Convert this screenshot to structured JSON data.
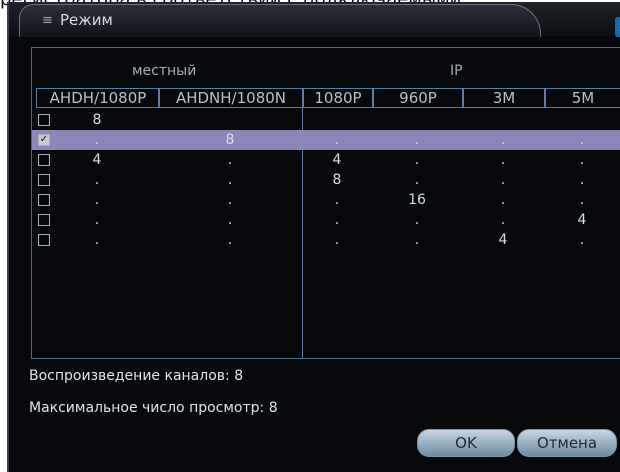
{
  "top_caption": "регистратора в соответствии с подключаемыми",
  "window": {
    "title": "Режим"
  },
  "groups": {
    "local": "местный",
    "ip": "IP"
  },
  "columns": [
    "AHDH/1080P",
    "AHDNH/1080N",
    "1080P",
    "960P",
    "3M",
    "5M"
  ],
  "rows": [
    {
      "checked": false,
      "cells": [
        "8",
        "",
        "",
        "",
        "",
        ""
      ]
    },
    {
      "checked": true,
      "cells": [
        ".",
        "8",
        ".",
        ".",
        ".",
        "."
      ]
    },
    {
      "checked": false,
      "cells": [
        "4",
        ".",
        "4",
        ".",
        ".",
        "."
      ]
    },
    {
      "checked": false,
      "cells": [
        ".",
        ".",
        "8",
        ".",
        ".",
        "."
      ]
    },
    {
      "checked": false,
      "cells": [
        ".",
        ".",
        ".",
        "16",
        ".",
        "."
      ]
    },
    {
      "checked": false,
      "cells": [
        ".",
        ".",
        ".",
        ".",
        ".",
        "4"
      ]
    },
    {
      "checked": false,
      "cells": [
        ".",
        ".",
        ".",
        ".",
        "4",
        "."
      ]
    }
  ],
  "footer": {
    "playback": "Воспроизведение каналов: 8",
    "max_view": "Максимальное число просмотр: 8"
  },
  "buttons": {
    "ok": "OK",
    "cancel": "Отмена"
  }
}
